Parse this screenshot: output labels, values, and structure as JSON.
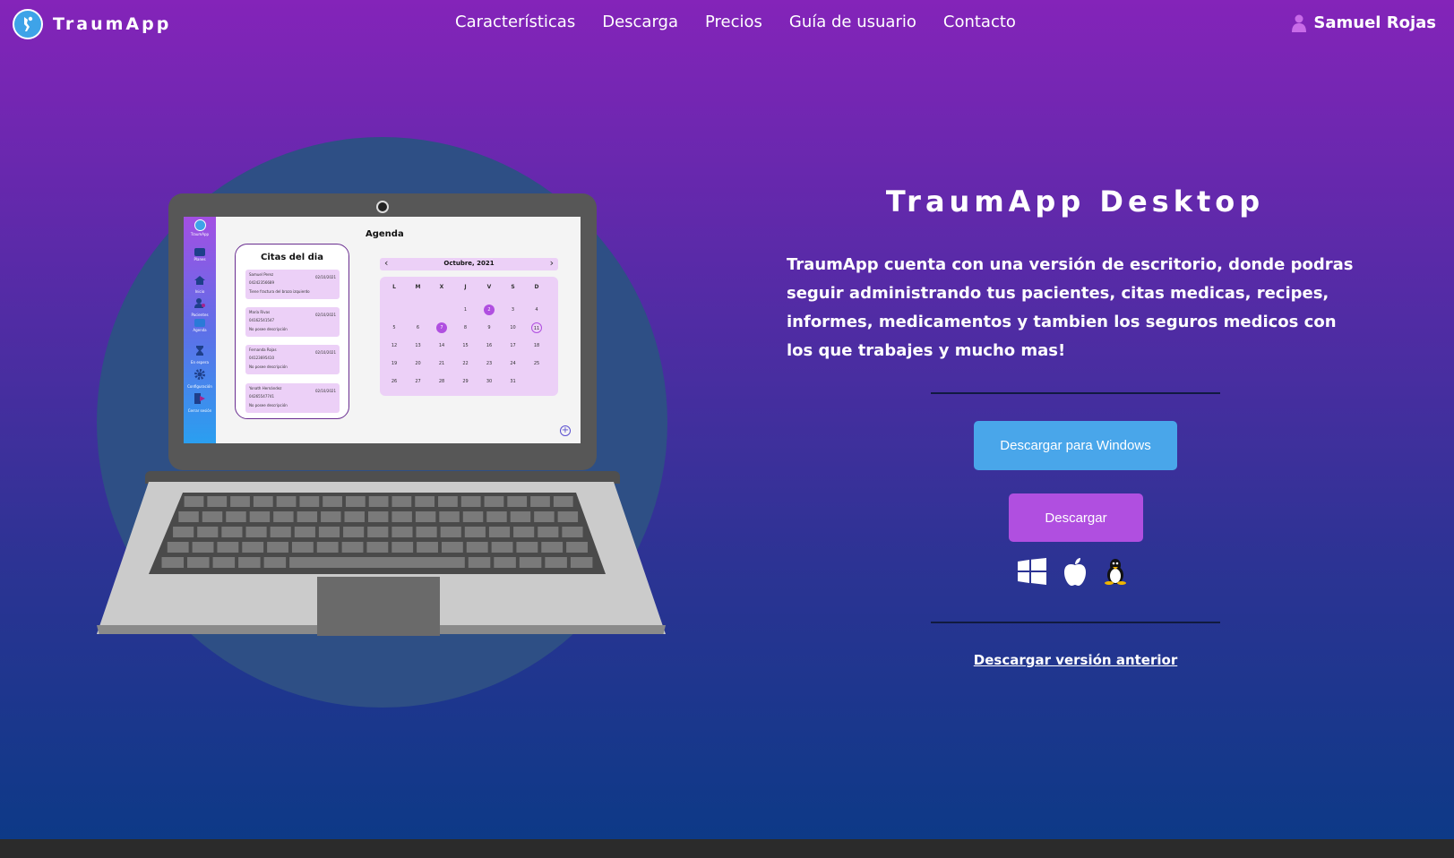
{
  "brand": {
    "name": "TraumApp",
    "icon": "traumapp-logo"
  },
  "nav": {
    "items": [
      "Características",
      "Descarga",
      "Precios",
      "Guía de usuario",
      "Contacto"
    ]
  },
  "user": {
    "name": "Samuel Rojas",
    "icon": "user-icon"
  },
  "mockup": {
    "screen_title": "Agenda",
    "sidebar": [
      {
        "label": "TraumApp",
        "icon": "traumapp-logo"
      },
      {
        "label": "Planes",
        "icon": "card-icon"
      },
      {
        "label": "Inicio",
        "icon": "home-icon"
      },
      {
        "label": "Pacientes",
        "icon": "patients-icon"
      },
      {
        "label": "Agenda",
        "icon": "calendar-icon"
      },
      {
        "label": "En espera",
        "icon": "hourglass-icon"
      },
      {
        "label": "Configuración",
        "icon": "gear-icon"
      },
      {
        "label": "Cerrar sesión",
        "icon": "logout-icon"
      }
    ],
    "citas_title": "Citas del dia",
    "citas": [
      {
        "name": "Samuel Perez",
        "phone": "04242356689",
        "date": "02/10/2021",
        "desc": "Tiene fractura del brazo izquierdo"
      },
      {
        "name": "María Rivas",
        "phone": "04162541547",
        "date": "02/10/2021",
        "desc": "No posee descripción"
      },
      {
        "name": "Fernanda Rojas",
        "phone": "04123695410",
        "date": "02/10/2021",
        "desc": "No posee descripción"
      },
      {
        "name": "Yonath Hernández",
        "phone": "04265547741",
        "date": "02/10/2021",
        "desc": "No posee descripción"
      }
    ],
    "calendar": {
      "month": "Octubre, 2021",
      "weekdays": [
        "L",
        "M",
        "X",
        "J",
        "V",
        "S",
        "D"
      ],
      "rows": [
        [
          "",
          "",
          "",
          "1",
          "2",
          "3",
          "4"
        ],
        [
          "5",
          "6",
          "7",
          "8",
          "9",
          "10",
          "11"
        ],
        [
          "12",
          "13",
          "14",
          "15",
          "16",
          "17",
          "18"
        ],
        [
          "19",
          "20",
          "21",
          "22",
          "23",
          "24",
          "25"
        ],
        [
          "26",
          "27",
          "28",
          "29",
          "30",
          "31",
          ""
        ]
      ],
      "selected": [
        "2",
        "7"
      ],
      "today": "11"
    }
  },
  "hero": {
    "title": "TraumApp Desktop",
    "description": "TraumApp cuenta con una versión de escritorio, donde podras seguir administrando tus pacientes, citas medicas, recipes, informes, medicamentos y tambien los seguros medicos con los que trabajes y mucho mas!",
    "download_windows": "Descargar para Windows",
    "download": "Descargar",
    "os_icons": [
      "windows-icon",
      "apple-icon",
      "linux-icon"
    ],
    "previous_version": "Descargar versión anterior"
  },
  "colors": {
    "accent_purple": "#b04fe0",
    "accent_blue": "#49a6ea",
    "footer": "#2b2b2b"
  }
}
